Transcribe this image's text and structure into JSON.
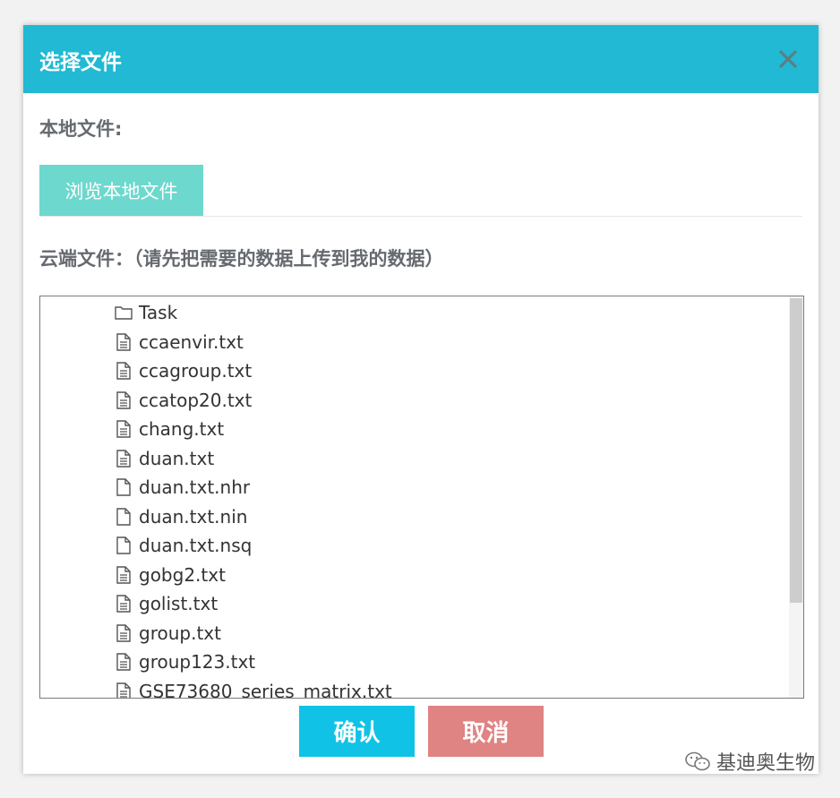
{
  "dialog": {
    "title": "选择文件",
    "local_label": "本地文件:",
    "browse_label": "浏览本地文件",
    "cloud_label": "云端文件：（请先把需要的数据上传到我的数据）",
    "files": [
      {
        "name": "Task",
        "icon": "folder-icon"
      },
      {
        "name": "ccaenvir.txt",
        "icon": "text-file-icon"
      },
      {
        "name": "ccagroup.txt",
        "icon": "text-file-icon"
      },
      {
        "name": "ccatop20.txt",
        "icon": "text-file-icon"
      },
      {
        "name": "chang.txt",
        "icon": "text-file-icon"
      },
      {
        "name": "duan.txt",
        "icon": "text-file-icon"
      },
      {
        "name": "duan.txt.nhr",
        "icon": "blank-file-icon"
      },
      {
        "name": "duan.txt.nin",
        "icon": "blank-file-icon"
      },
      {
        "name": "duan.txt.nsq",
        "icon": "blank-file-icon"
      },
      {
        "name": "gobg2.txt",
        "icon": "text-file-icon"
      },
      {
        "name": "golist.txt",
        "icon": "text-file-icon"
      },
      {
        "name": "group.txt",
        "icon": "text-file-icon"
      },
      {
        "name": "group123.txt",
        "icon": "text-file-icon"
      },
      {
        "name": "GSE73680_series_matrix.txt",
        "icon": "text-file-icon"
      }
    ],
    "confirm_label": "确认",
    "cancel_label": "取消"
  },
  "watermark": "基迪奥生物",
  "colors": {
    "header": "#21b9d3",
    "browse": "#6dd8cd",
    "confirm": "#10c3e6",
    "cancel": "#e08383"
  }
}
